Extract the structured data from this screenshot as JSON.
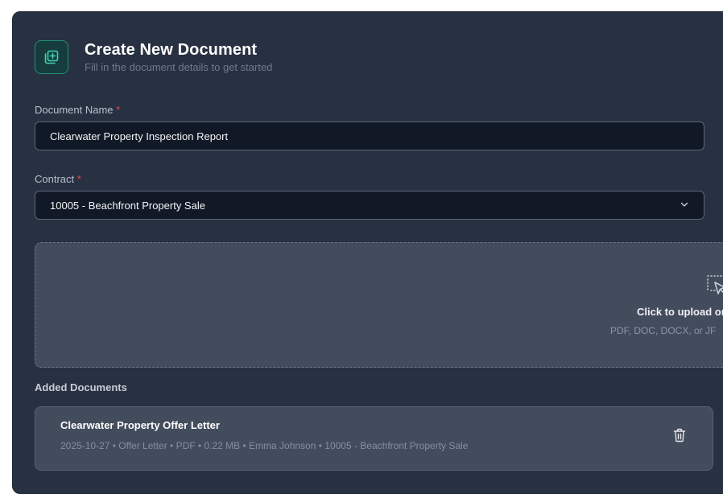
{
  "header": {
    "icon": "add-document-icon",
    "title": "Create New Document",
    "subtitle": "Fill in the document details to get started"
  },
  "form": {
    "document_name": {
      "label": "Document Name",
      "required_mark": "*",
      "value": "Clearwater Property Inspection Report"
    },
    "contract": {
      "label": "Contract",
      "required_mark": "*",
      "selected": "10005 - Beachfront Property Sale",
      "icon": "chevron-down-icon"
    }
  },
  "upload": {
    "icon": "upload-cursor-icon",
    "text": "Click to upload or",
    "hint": "PDF, DOC, DOCX, or JF"
  },
  "added_documents": {
    "title": "Added Documents",
    "items": [
      {
        "name": "Clearwater Property Offer Letter",
        "meta": "2025-10-27 • Offer Letter • PDF • 0.22 MB • Emma Johnson • 10005 - Beachfront Property Sale",
        "icon": "trash-icon"
      }
    ]
  },
  "colors": {
    "panel_bg": "#283141",
    "accent": "#1f8f76",
    "required": "#ef4444",
    "input_bg": "#121926"
  }
}
